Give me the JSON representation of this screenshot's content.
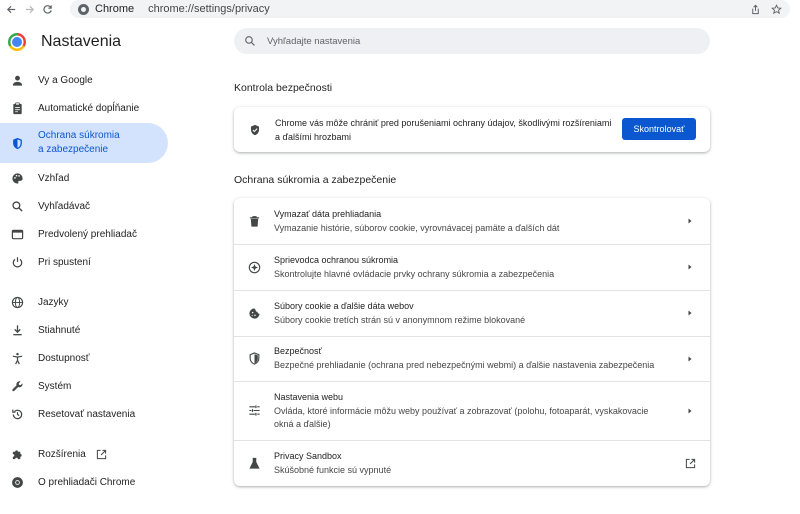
{
  "browser": {
    "site_label": "Chrome",
    "url": "chrome://settings/privacy"
  },
  "sidebar": {
    "title": "Nastavenia",
    "items": [
      {
        "label": "Vy a Google",
        "icon": "person-icon"
      },
      {
        "label": "Automatické dopĺňanie",
        "icon": "clipboard-icon"
      },
      {
        "label_line1": "Ochrana súkromia",
        "label_line2": "a zabezpečenie",
        "icon": "shield-icon",
        "active": true
      },
      {
        "label": "Vzhľad",
        "icon": "palette-icon"
      },
      {
        "label": "Vyhľadávač",
        "icon": "search-icon"
      },
      {
        "label": "Predvolený prehliadač",
        "icon": "browser-icon"
      },
      {
        "label": "Pri spustení",
        "icon": "power-icon"
      },
      {
        "label": "Jazyky",
        "icon": "globe-icon"
      },
      {
        "label": "Stiahnuté",
        "icon": "download-icon"
      },
      {
        "label": "Dostupnosť",
        "icon": "accessibility-icon"
      },
      {
        "label": "Systém",
        "icon": "wrench-icon"
      },
      {
        "label": "Resetovať nastavenia",
        "icon": "reset-icon"
      },
      {
        "label": "Rozšírenia",
        "icon": "puzzle-icon"
      },
      {
        "label": "O prehliadači Chrome",
        "icon": "chrome-icon"
      }
    ]
  },
  "search": {
    "placeholder": "Vyhľadajte nastavenia"
  },
  "safety_check": {
    "section_title": "Kontrola bezpečnosti",
    "text": "Chrome vás môže chrániť pred porušeniami ochrany údajov, škodlivými rozšíreniami a ďalšími hrozbami",
    "button_label": "Skontrolovať"
  },
  "privacy": {
    "section_title": "Ochrana súkromia a zabezpečenie",
    "rows": [
      {
        "title": "Vymazať dáta prehliadania",
        "subtitle": "Vymazanie histórie, súborov cookie, vyrovnávacej pamäte a ďalších dát",
        "icon": "trash-icon"
      },
      {
        "title": "Sprievodca ochranou súkromia",
        "subtitle": "Skontrolujte hlavné ovládacie prvky ochrany súkromia a zabezpečenia",
        "icon": "compass-icon"
      },
      {
        "title": "Súbory cookie a ďalšie dáta webov",
        "subtitle": "Súbory cookie tretích strán sú v anonymnom režime blokované",
        "icon": "cookie-icon"
      },
      {
        "title": "Bezpečnosť",
        "subtitle": "Bezpečné prehliadanie (ochrana pred nebezpečnými webmi) a ďalšie nastavenia zabezpečenia",
        "icon": "security-shield-icon"
      },
      {
        "title": "Nastavenia webu",
        "subtitle": "Ovláda, ktoré informácie môžu weby používať a zobrazovať (polohu, fotoaparát, vyskakovacie okná a ďalšie)",
        "icon": "tune-icon"
      },
      {
        "title": "Privacy Sandbox",
        "subtitle": "Skúšobné funkcie sú vypnuté",
        "icon": "flask-icon"
      }
    ]
  },
  "colors": {
    "accent": "#0b57d0",
    "active_bg": "#d3e3fd"
  }
}
